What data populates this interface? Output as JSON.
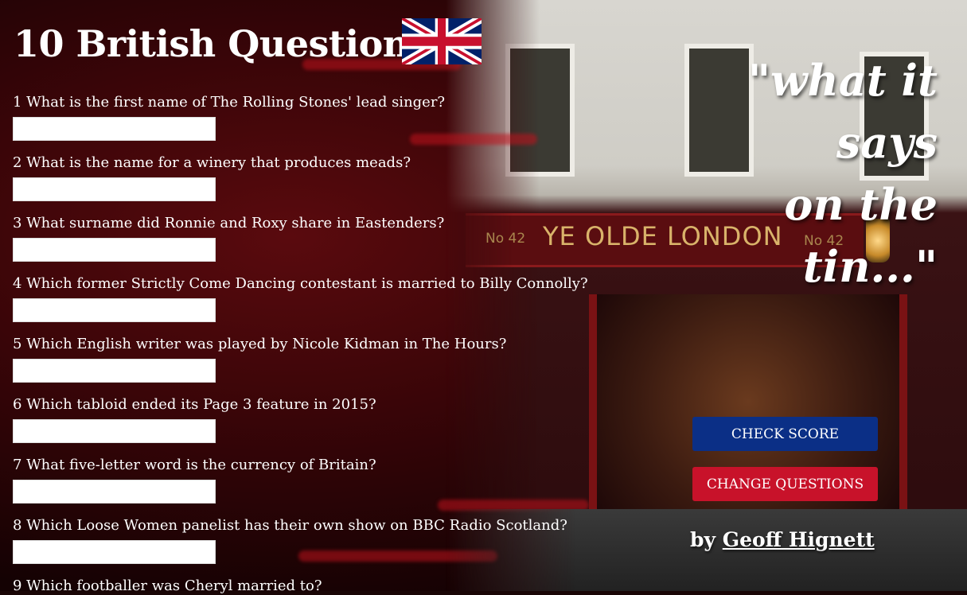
{
  "page": {
    "title": "10 British Questions",
    "tagline_line1": "\"what it says",
    "tagline_line2": "on the tin...\"",
    "byline_prefix": "by",
    "author": "Geoff Hignett",
    "check_score_label": "CHECK SCORE",
    "change_questions_label": "CHANGE QUESTIONS"
  },
  "sign": {
    "name": "YE OLDE LONDON",
    "number_left": "No 42",
    "number_right": "No 42"
  },
  "questions": [
    {
      "text": "1 What is the first name of The Rolling Stones' lead singer?",
      "answer": ""
    },
    {
      "text": "2 What is the name for a winery that produces meads?",
      "answer": ""
    },
    {
      "text": "3 What surname did Ronnie and Roxy share in Eastenders?",
      "answer": ""
    },
    {
      "text": "4 Which former Strictly Come Dancing contestant is married to Billy Connolly?",
      "answer": ""
    },
    {
      "text": "5 Which English writer was played by Nicole Kidman in The Hours?",
      "answer": ""
    },
    {
      "text": "6 Which tabloid ended its Page 3 feature in 2015?",
      "answer": ""
    },
    {
      "text": "7 What five-letter word is the currency of Britain?",
      "answer": ""
    },
    {
      "text": "8 Which Loose Women panelist has their own show on BBC Radio Scotland?",
      "answer": ""
    },
    {
      "text": "9 Which footballer was Cheryl married to?",
      "answer": ""
    }
  ],
  "colors": {
    "check_button": "#0b2f86",
    "change_button": "#c8122a",
    "background": "#3a0508"
  },
  "icons": {
    "flag": "union-jack-flag-icon"
  }
}
